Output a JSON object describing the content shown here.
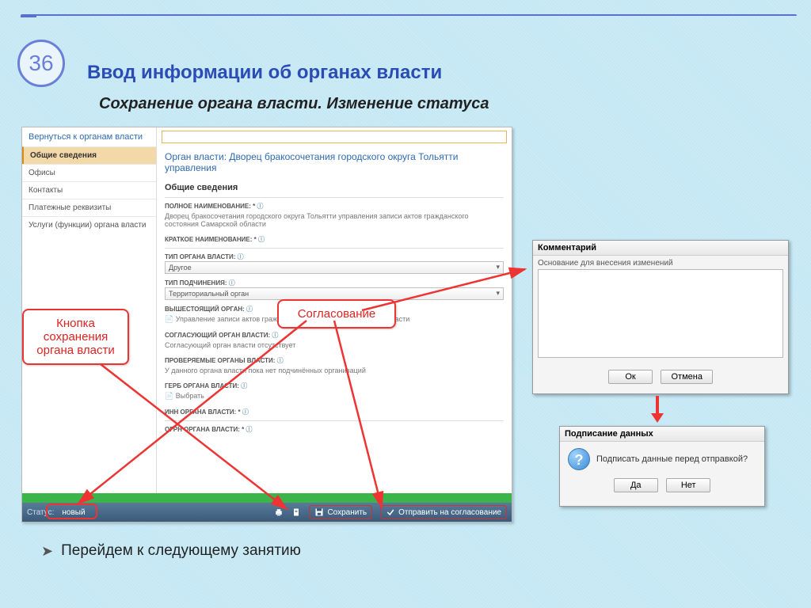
{
  "slide": {
    "number": "36",
    "title": "Ввод информации об органах власти",
    "subtitle": "Сохранение органа власти. Изменение статуса",
    "bullet": "Перейдем к следующему занятию"
  },
  "app": {
    "back_link": "Вернуться к органам власти",
    "nav": {
      "general": "Общие сведения",
      "offices": "Офисы",
      "contacts": "Контакты",
      "payment": "Платежные реквизиты",
      "services": "Услуги (функции) органа власти"
    },
    "authority_title": "Орган власти: Дворец бракосочетания городского округа Тольятти управления",
    "section": "Общие сведения",
    "fields": {
      "full_name_label": "ПОЛНОЕ НАИМЕНОВАНИЕ: *",
      "full_name_value": "Дворец бракосочетания городского округа Тольятти управления записи актов гражданского состояния Самарской области",
      "short_name_label": "КРАТКОЕ НАИМЕНОВАНИЕ: *",
      "type_label": "ТИП ОРГАНА ВЛАСТИ:",
      "type_value": "Другое",
      "subord_label": "ТИП ПОДЧИНЕНИЯ:",
      "subord_value": "Территориальный орган",
      "parent_label": "ВЫШЕСТОЯЩИЙ ОРГАН:",
      "parent_value": "Управление записи актов гражданского состояния Самарской области",
      "approver_label": "СОГЛАСУЮЩИЙ ОРГАН ВЛАСТИ:",
      "approver_value": "Согласующий орган власти отсутствует",
      "checking_label": "ПРОВЕРЯЕМЫЕ ОРГАНЫ ВЛАСТИ:",
      "checking_value": "У данного органа власти пока нет подчинённых организаций",
      "emblem_label": "ГЕРБ ОРГАНА ВЛАСТИ:",
      "emblem_button": "Выбрать",
      "inn_label": "ИНН ОРГАНА ВЛАСТИ: *",
      "ogrn_label": "ОГРН ОРГАНА ВЛАСТИ: *"
    },
    "statusbar": {
      "status_label": "Статус:",
      "status_value": "новый",
      "save": "Сохранить",
      "submit": "Отправить на согласование"
    }
  },
  "callouts": {
    "save": "Кнопка\nсохранения\nоргана власти",
    "approve": "Согласование"
  },
  "comment_dialog": {
    "title": "Комментарий",
    "label": "Основание для внесения изменений",
    "ok": "Ок",
    "cancel": "Отмена"
  },
  "sign_dialog": {
    "title": "Подписание данных",
    "message": "Подписать данные перед отправкой?",
    "yes": "Да",
    "no": "Нет"
  }
}
